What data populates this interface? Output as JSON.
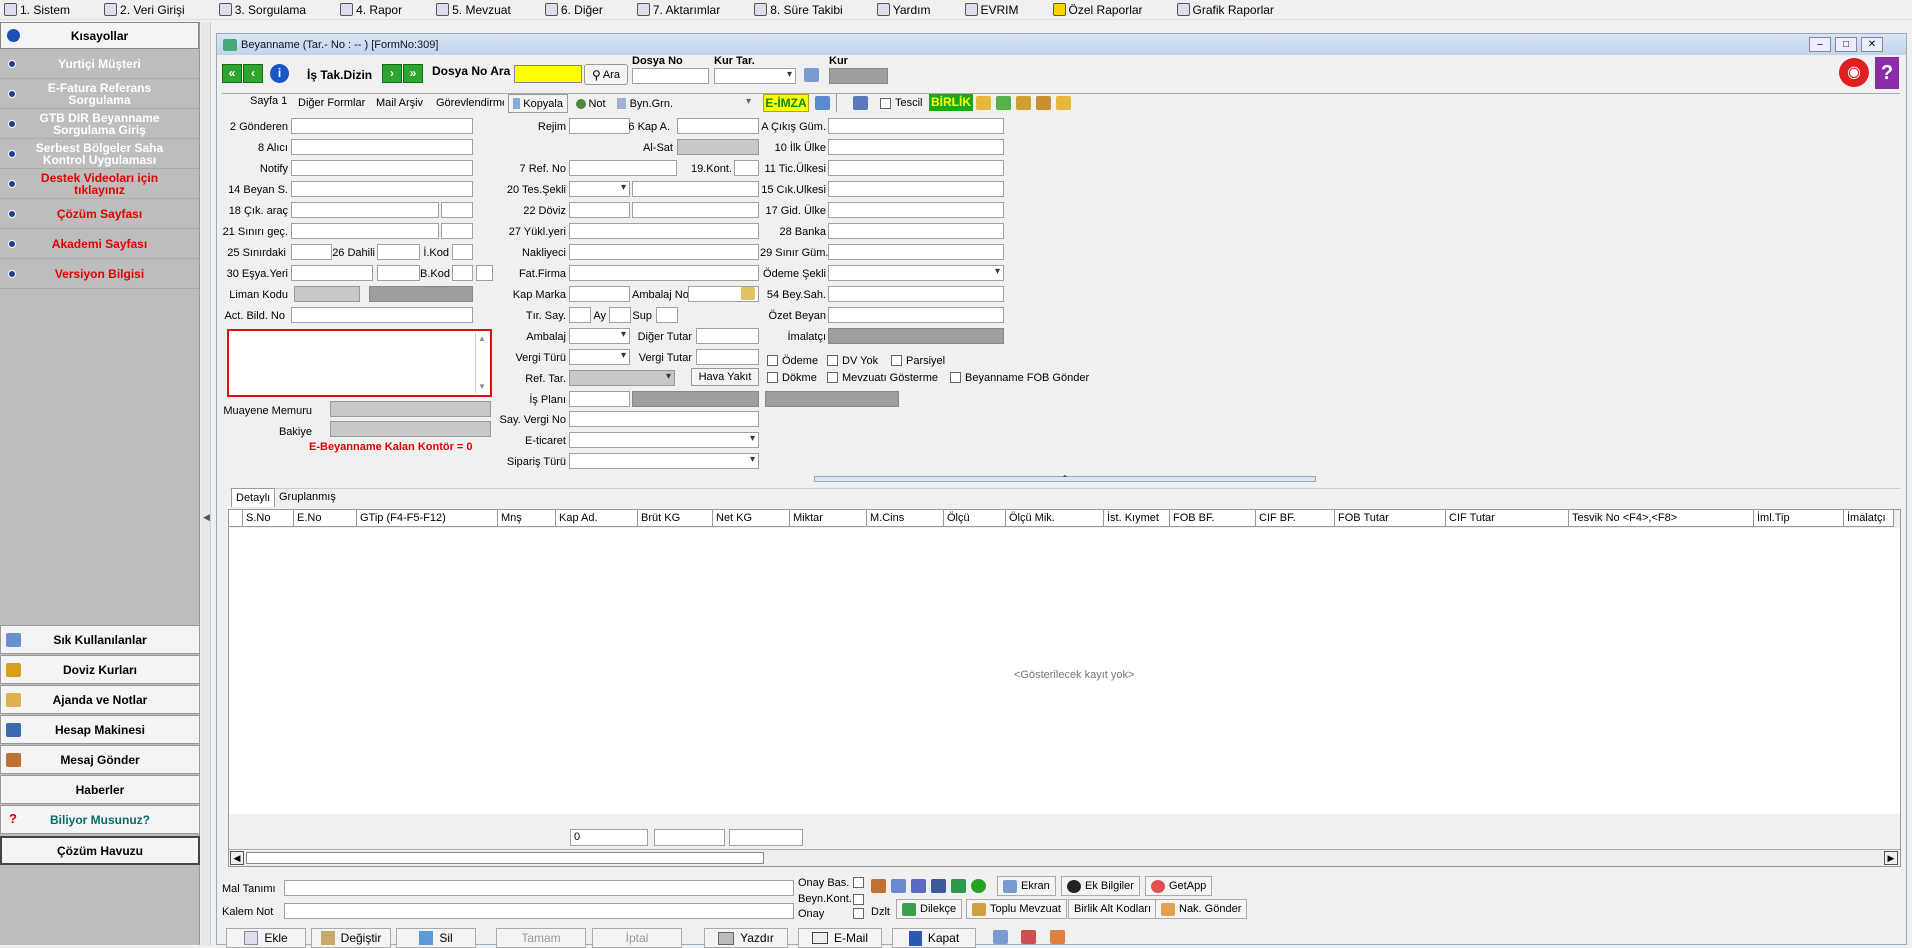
{
  "menu": [
    {
      "label": "1.  Sistem",
      "icon": "system-icon"
    },
    {
      "label": "2.  Veri Girişi",
      "icon": "data-entry-icon"
    },
    {
      "label": "3.  Sorgulama",
      "icon": "query-icon"
    },
    {
      "label": "4.  Rapor",
      "icon": "printer-icon"
    },
    {
      "label": "5.  Mevzuat",
      "icon": "books-icon"
    },
    {
      "label": "6.  Diğer",
      "icon": "other-icon"
    },
    {
      "label": "7.  Aktarımlar",
      "icon": "transfer-icon"
    },
    {
      "label": "8. Süre Takibi",
      "icon": "calendar-icon"
    },
    {
      "label": "Yardım",
      "icon": "help-icon"
    },
    {
      "label": "EVRIM",
      "icon": "evrim-icon"
    },
    {
      "label": "Özel Raporlar",
      "icon": "star-icon"
    },
    {
      "label": "Grafik Raporlar",
      "icon": "chart-icon"
    }
  ],
  "sidebar": {
    "title": "Kısayollar",
    "items": [
      {
        "label": "Yurtiçi Müşteri",
        "red": false
      },
      {
        "label": "E-Fatura Referans Sorgulama",
        "red": false
      },
      {
        "label": "GTB DIR Beyanname Sorgulama Giriş",
        "red": false
      },
      {
        "label": "Serbest Bölgeler Saha Kontrol Uygulaması",
        "red": false
      },
      {
        "label": "Destek Videoları için tıklayınız",
        "red": true
      },
      {
        "label": "Çözüm Sayfası",
        "red": true
      },
      {
        "label": "Akademi Sayfası",
        "red": true
      },
      {
        "label": "Versiyon Bilgisi",
        "red": true
      }
    ],
    "bottom": [
      "Sık Kullanılanlar",
      "Doviz Kurları",
      "Ajanda ve Notlar",
      "Hesap Makinesi",
      "Mesaj Gönder",
      "Haberler",
      "Biliyor Musunuz?",
      "Çözüm Havuzu"
    ]
  },
  "window": {
    "title": "Beyanname (Tar.- No :  -- )  [FormNo:309]"
  },
  "top": {
    "is_tak": "İş Tak.Dizin",
    "dosya_no_ara": "Dosya No Ara",
    "ara": "Ara",
    "dosya_no": "Dosya No",
    "kur_tar": "Kur Tar.",
    "kur": "Kur"
  },
  "tabs": [
    "Sayfa 1",
    "Diğer Formlar",
    "Mail Arşiv",
    "Görevlendirme"
  ],
  "toolbar": {
    "kopyala": "Kopyala",
    "not": "Not",
    "byn": "Byn.Grn.",
    "eimza": "E-İMZA",
    "tescil": "Tescil",
    "birlik": "BİRLİK"
  },
  "fields": {
    "gonderen": "2 Gönderen",
    "alici": "8 Alıcı",
    "notify": "Notify",
    "beyan": "14 Beyan S.",
    "cik_arac": "18 Çık. araç",
    "sinir_gec": "21 Sınırı geç.",
    "sinirdaki": "25 Sınırdaki",
    "dahili": "26 Dahili",
    "ikod": "İ.Kod",
    "esya": "30 Eşya.Yeri",
    "bkod": "B.Kod",
    "liman": "Liman Kodu",
    "act": "Act. Bild. No",
    "rejim": "Rejim",
    "kap": "6 Kap A.",
    "alsat": "Al-Sat",
    "ref": "7 Ref. No",
    "kont": "19.Kont.",
    "tes": "20 Tes.Şekli",
    "doviz": "22 Döviz",
    "yukl": "27 Yükl.yeri",
    "nakl": "Nakliyeci",
    "fat": "Fat.Firma",
    "kapm": "Kap Marka",
    "amb_no": "Ambalaj No",
    "tir": "Tır. Say.",
    "ay": "Ay",
    "sup": "Sup",
    "ambalaj": "Ambalaj",
    "diger": "Diğer Tutar",
    "vergi_turu": "Vergi Türü",
    "vergi_tutar": "Vergi Tutar",
    "ref_tar": "Ref. Tar.",
    "hava": "Hava Yakıt",
    "is_plani": "İş Planı",
    "say_vergi": "Say. Vergi No",
    "eticaret": "E-ticaret",
    "siparis": "Sipariş Türü",
    "cikis": "A Çıkış Güm.",
    "ilk": "10 İlk Ülke",
    "tic": "11 Tic.Ülkesi",
    "cik_ul": "15 Cık.Ulkesi",
    "gid": "17 Gid. Ülke",
    "banka": "28 Banka",
    "sinir_gum": "29 Sınır Güm.",
    "odeme": "Ödeme Şekli",
    "bey_sah": "54 Bey.Sah.",
    "ozet": "Özet Beyan",
    "imalat": "İmalatçı",
    "muayene": "Muayene Memuru",
    "bakiye": "Bakiye",
    "kontor": "E-Beyanname Kalan Kontör = 0"
  },
  "checks": [
    "Ödeme",
    "DV Yok",
    "Parsiyel",
    "Dökme",
    "Mevzuatı Gösterme",
    "Beyanname FOB Gönder"
  ],
  "grid": {
    "tabs": [
      "Detaylı",
      "Gruplanmış"
    ],
    "columns": [
      "S.No",
      "E.No",
      "GTip (F4-F5-F12)",
      "Mnş",
      "Kap Ad.",
      "Brüt KG",
      "Net KG",
      "Miktar",
      "M.Cins",
      "Ölçü",
      "Ölçü Mik.",
      "İst. Kıymet",
      "FOB BF.",
      "CIF BF.",
      "FOB Tutar",
      "CIF Tutar",
      "Tesvik No <F4>,<F8>",
      "İml.Tip",
      "İmalatçı"
    ],
    "empty": "<Gösterilecek kayıt yok>",
    "footer_value": "0"
  },
  "bottom_panel": {
    "mal": "Mal Tanımı",
    "kalem": "Kalem Not",
    "onay_bas": "Onay Bas.",
    "beyn_kont": "Beyn.Kont.",
    "onay": "Onay",
    "dzlt": "Dzlt",
    "ekran": "Ekran",
    "ek": "Ek Bilgiler",
    "getapp": "GetApp",
    "dilekce": "Dilekçe",
    "toplu": "Toplu Mevzuat",
    "birlik_alt": "Birlik Alt Kodları",
    "nak": "Nak. Gönder"
  },
  "actions": [
    "Ekle",
    "Değiştir",
    "Sil",
    "Tamam",
    "İptal",
    "Yazdır",
    "E-Mail",
    "Kapat"
  ]
}
